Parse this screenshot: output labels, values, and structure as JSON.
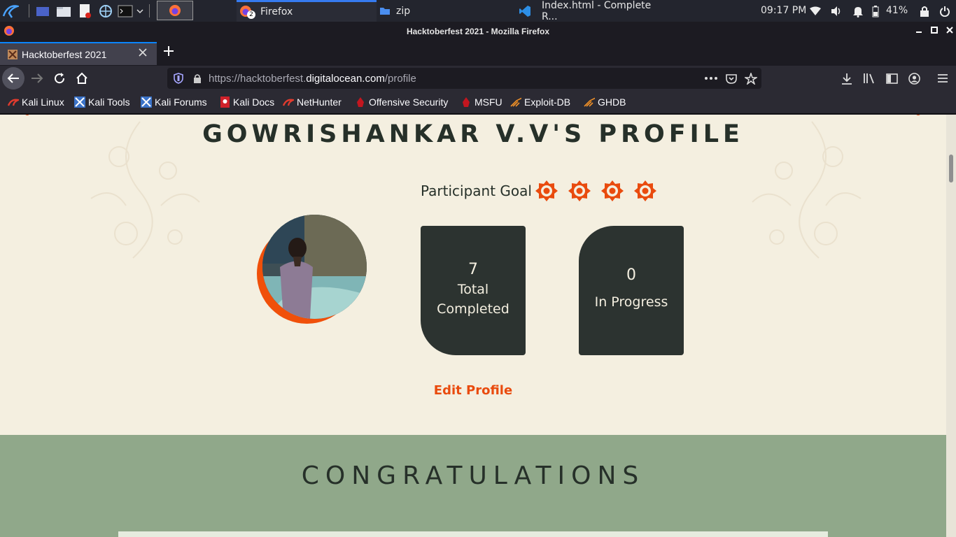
{
  "taskbar": {
    "tasks": [
      {
        "label": "Firefox",
        "badge": "2"
      },
      {
        "label": "zip"
      },
      {
        "label": "Index.html - Complete R..."
      }
    ],
    "clock": "09:17 PM",
    "battery": "41%"
  },
  "window": {
    "title": "Hacktoberfest 2021 - Mozilla Firefox"
  },
  "tab": {
    "title": "Hacktoberfest 2021"
  },
  "urlbar": {
    "scheme_sub": "https://hacktoberfest.",
    "domain": "digitalocean.com",
    "path": "/profile"
  },
  "bookmarks": [
    "Kali Linux",
    "Kali Tools",
    "Kali Forums",
    "Kali Docs",
    "NetHunter",
    "Offensive Security",
    "MSFU",
    "Exploit-DB",
    "GHDB"
  ],
  "page": {
    "title": "GOWRISHANKAR V.V'S PROFILE",
    "goal_label": "Participant Goal",
    "goal_icons": 4,
    "total": {
      "value": "7",
      "label": "Total Completed"
    },
    "progress": {
      "value": "0",
      "label": "In Progress"
    },
    "edit_link": "Edit Profile",
    "congrats": "CONGRATULATIONS"
  },
  "colors": {
    "accent": "#e94b0e",
    "dark": "#2c3330",
    "cream": "#f4efe0",
    "green": "#90a88a"
  }
}
